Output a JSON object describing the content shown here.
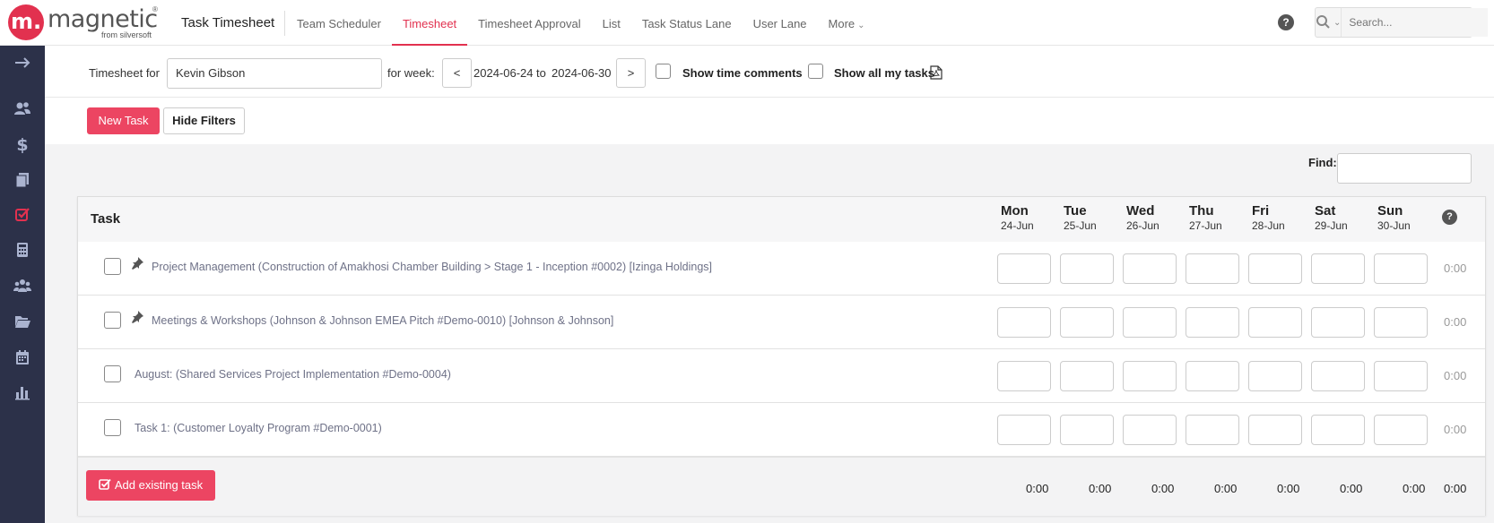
{
  "brand": {
    "name": "magnetic",
    "sub": "from silversoft",
    "reg": "®",
    "mark": "m."
  },
  "header": {
    "app_title": "Task Timesheet",
    "nav": [
      {
        "label": "Team Scheduler",
        "active": false
      },
      {
        "label": "Timesheet",
        "active": true
      },
      {
        "label": "Timesheet Approval",
        "active": false
      },
      {
        "label": "List",
        "active": false
      },
      {
        "label": "Task Status Lane",
        "active": false
      },
      {
        "label": "User Lane",
        "active": false
      },
      {
        "label": "More",
        "active": false
      }
    ],
    "help": "?",
    "search_placeholder": "Search..."
  },
  "sidebar": {
    "items": [
      "expand-arrow-icon",
      "contacts-icon",
      "dollar-icon",
      "documents-icon",
      "tasks-check-icon",
      "calculator-icon",
      "team-icon",
      "folder-icon",
      "calendar-icon",
      "reports-chart-icon"
    ],
    "active_item": "tasks-check-icon"
  },
  "filters": {
    "timesheet_for_label": "Timesheet for",
    "timesheet_for_value": "Kevin Gibson",
    "for_week_label": "for week:",
    "prev": "<",
    "next": ">",
    "week_start": "2024-06-24",
    "to_label": "to",
    "week_end": "2024-06-30",
    "show_time_comments": "Show time comments",
    "show_all_my_tasks": "Show all my tasks"
  },
  "actions": {
    "new_task": "New Task",
    "hide_filters": "Hide Filters"
  },
  "find_label": "Find:",
  "table": {
    "task_header": "Task",
    "help": "?",
    "days": [
      {
        "day": "Mon",
        "date": "24-Jun"
      },
      {
        "day": "Tue",
        "date": "25-Jun"
      },
      {
        "day": "Wed",
        "date": "26-Jun"
      },
      {
        "day": "Thu",
        "date": "27-Jun"
      },
      {
        "day": "Fri",
        "date": "28-Jun"
      },
      {
        "day": "Sat",
        "date": "29-Jun"
      },
      {
        "day": "Sun",
        "date": "30-Jun"
      }
    ],
    "rows": [
      {
        "name": "Project Management (Construction of Amakhosi Chamber Building > Stage 1 - Inception #0002) [Izinga Holdings]",
        "pinned": true,
        "total": "0:00"
      },
      {
        "name": "Meetings & Workshops (Johnson & Johnson EMEA Pitch #Demo-0010) [Johnson & Johnson]",
        "pinned": true,
        "total": "0:00"
      },
      {
        "name": "August: (Shared Services Project Implementation #Demo-0004)",
        "pinned": false,
        "total": "0:00"
      },
      {
        "name": "Task 1: (Customer Loyalty Program #Demo-0001)",
        "pinned": false,
        "total": "0:00"
      }
    ],
    "add_existing": "Add existing task",
    "day_totals": [
      "0:00",
      "0:00",
      "0:00",
      "0:00",
      "0:00",
      "0:00",
      "0:00"
    ],
    "grand_total": "0:00"
  },
  "colors": {
    "accent": "#e2314f",
    "button": "#ec4562",
    "sidebar": "#2c3149"
  }
}
